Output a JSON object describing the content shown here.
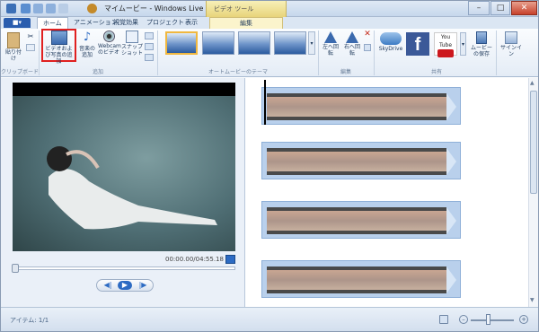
{
  "titlebar": {
    "title": "マイムービー - Windows Live ムービー メーカー",
    "context_header": "ビデオ ツール",
    "min": "–",
    "max": "□",
    "close": "✕"
  },
  "tabs": {
    "file": "■▾",
    "home": "ホーム",
    "animation": "アニメーション",
    "visual_effects": "視覚効果",
    "project": "プロジェクト",
    "view": "表示",
    "edit": "編集"
  },
  "ribbon": {
    "paste": "貼り付け",
    "clipboard_group": "クリップボード",
    "add_media": "ビデオおよび写真の追加",
    "add_music": "音楽の追加",
    "webcam": "Webcam のビデオ",
    "snapshot": "スナップショット",
    "add_group": "追加",
    "themes_group": "オートムービーのテーマ",
    "rotate_left": "左へ回転",
    "rotate_right": "右へ回転",
    "edit_group": "編集",
    "skydrive": "SkyDrive",
    "youtube": "You Tube",
    "save_movie": "ムービーの保存",
    "share_group": "共有",
    "signin": "サインイン"
  },
  "preview": {
    "timecode": "00:00.00/04:55.18",
    "prev": "◀|",
    "play": "▶",
    "next": "|▶"
  },
  "status": {
    "items": "アイテム: 1/1",
    "zoom_minus": "–",
    "zoom_plus": "+"
  },
  "colors": {
    "accent": "#2a5dae",
    "highlight_box": "#e02020",
    "facebook": "#3b5998",
    "youtube_red": "#cc181e"
  }
}
